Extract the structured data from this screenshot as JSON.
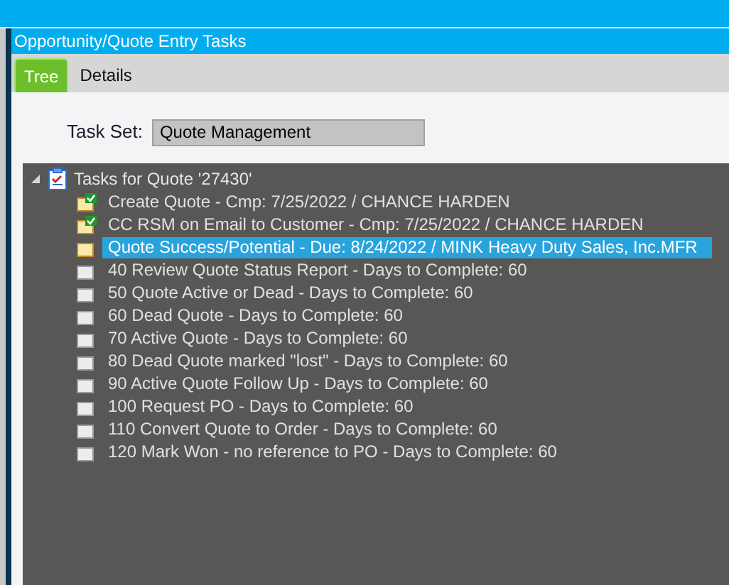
{
  "window": {
    "title": "Opportunity/Quote Entry Tasks"
  },
  "tabs": [
    {
      "label": "Tree",
      "selected": true
    },
    {
      "label": "Details",
      "selected": false
    }
  ],
  "task_set": {
    "label": "Task Set:",
    "value": "Quote Management"
  },
  "tree": {
    "label": "Tasks for Quote '27430'",
    "expanded": true,
    "children": [
      {
        "label": "Create Quote - Cmp: 7/25/2022 / CHANCE HARDEN",
        "kind": "completed",
        "selected": false
      },
      {
        "label": "CC RSM on Email to Customer - Cmp: 7/25/2022 / CHANCE HARDEN",
        "kind": "completed",
        "selected": false
      },
      {
        "label": "Quote Success/Potential - Due: 8/24/2022 / MINK Heavy Duty Sales, Inc.MFR",
        "kind": "due",
        "selected": true
      },
      {
        "label": "40 Review Quote Status Report - Days to Complete: 60",
        "kind": "planned",
        "selected": false
      },
      {
        "label": "50 Quote Active or Dead - Days to Complete: 60",
        "kind": "planned",
        "selected": false
      },
      {
        "label": "60 Dead Quote - Days to Complete: 60",
        "kind": "planned",
        "selected": false
      },
      {
        "label": "70 Active Quote - Days to Complete: 60",
        "kind": "planned",
        "selected": false
      },
      {
        "label": "80 Dead Quote marked \"lost\" - Days to Complete: 60",
        "kind": "planned",
        "selected": false
      },
      {
        "label": "90 Active Quote Follow Up - Days to Complete: 60",
        "kind": "planned",
        "selected": false
      },
      {
        "label": "100 Request PO - Days to Complete: 60",
        "kind": "planned",
        "selected": false
      },
      {
        "label": "110 Convert Quote to Order - Days to Complete: 60",
        "kind": "planned",
        "selected": false
      },
      {
        "label": "120 Mark Won - no reference to PO - Days to Complete: 60",
        "kind": "planned",
        "selected": false
      }
    ]
  }
}
